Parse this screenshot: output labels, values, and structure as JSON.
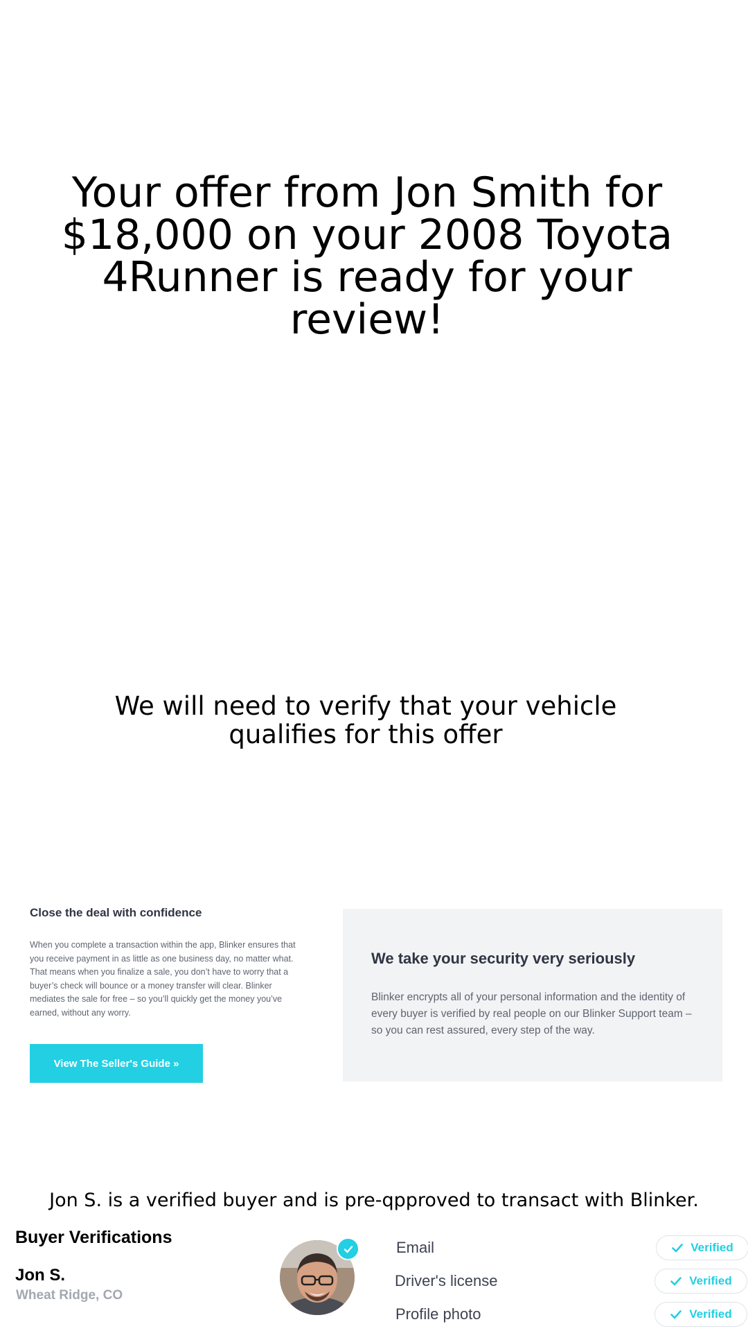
{
  "offer": {
    "headline": "Your offer from Jon Smith for $18,000 on your 2008 Toyota 4Runner is ready for your review!",
    "verify_note": "We will need to verify that your vehicle qualifies for this offer"
  },
  "confidence": {
    "heading": "Close the deal with confidence",
    "body": "When you complete a transaction within the app, Blinker ensures that you receive payment in as little as one business day, no matter what. That means when you finalize a sale, you don’t have to worry that a buyer’s check will bounce or a money transfer will clear. Blinker mediates the sale for free – so you’ll quickly get the money you’ve earned, without any worry.",
    "button_label": "View The Seller's Guide »",
    "button_color": "#22cfe3"
  },
  "security": {
    "heading": "We take your security very seriously",
    "body": "Blinker encrypts all of your personal information and the identity of every buyer is verified by real people on our Blinker Support team – so you can rest assured, every step of the way."
  },
  "buyer": {
    "statement": "Jon S. is a verified buyer and is pre-qpproved to transact with Blinker.",
    "verifications_heading": "Buyer Verifications",
    "name": "Jon S.",
    "location": "Wheat Ridge, CO",
    "avatar_badge_icon": "check-circle-icon",
    "checks": [
      {
        "label": "Email",
        "status": "Verified"
      },
      {
        "label": "Driver's license",
        "status": "Verified"
      },
      {
        "label": "Profile photo",
        "status": "Verified"
      }
    ]
  }
}
